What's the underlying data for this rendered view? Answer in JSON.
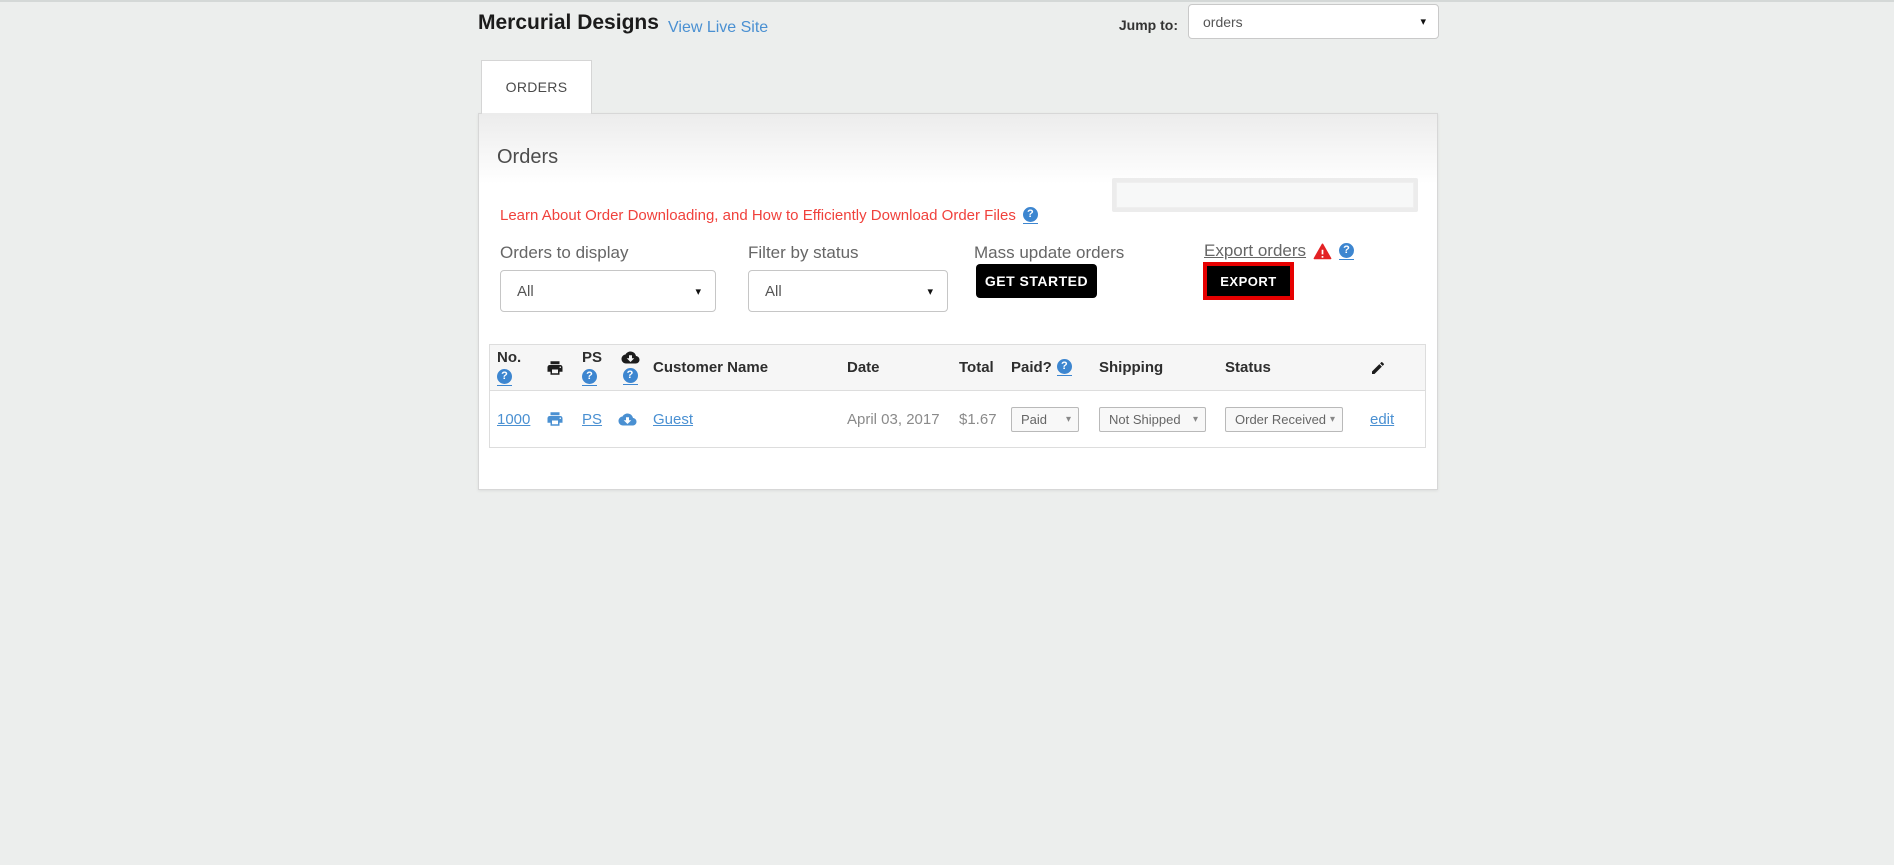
{
  "header": {
    "store_name": "Mercurial Designs",
    "view_live_site": "View Live Site",
    "jump_to_label": "Jump to:",
    "jump_to_value": "orders"
  },
  "tab": {
    "label": "ORDERS"
  },
  "panel": {
    "title": "Orders",
    "help_link_text": "Learn About Order Downloading, and How to Efficiently Download Order Files",
    "controls": {
      "orders_to_display": {
        "label": "Orders to display",
        "value": "All"
      },
      "filter_by_status": {
        "label": "Filter by status",
        "value": "All"
      },
      "mass_update": {
        "label": "Mass update orders",
        "button_label": "GET STARTED"
      },
      "export": {
        "label": "Export orders",
        "button_label": "EXPORT"
      }
    }
  },
  "table": {
    "headers": {
      "no": "No.",
      "ps": "PS",
      "customer_name": "Customer Name",
      "date": "Date",
      "total": "Total",
      "paid": "Paid?",
      "shipping": "Shipping",
      "status": "Status"
    },
    "rows": [
      {
        "order_no": "1000",
        "ps_label": "PS",
        "customer": "Guest",
        "date": "April 03, 2017",
        "total": "$1.67",
        "paid_value": "Paid",
        "shipping_value": "Not Shipped",
        "status_value": "Order Received",
        "edit_label": "edit"
      }
    ]
  },
  "icons": {
    "help_glyph": "?",
    "dropdown_arrow": "▾"
  },
  "colors": {
    "accent_blue": "#4a90d2",
    "help_icon_blue": "#3d86d0",
    "alert_link_red": "#f0413c",
    "warning_red": "#e32224",
    "export_highlight_red": "#e60000",
    "button_black": "#000000",
    "page_background": "#eceeed"
  }
}
